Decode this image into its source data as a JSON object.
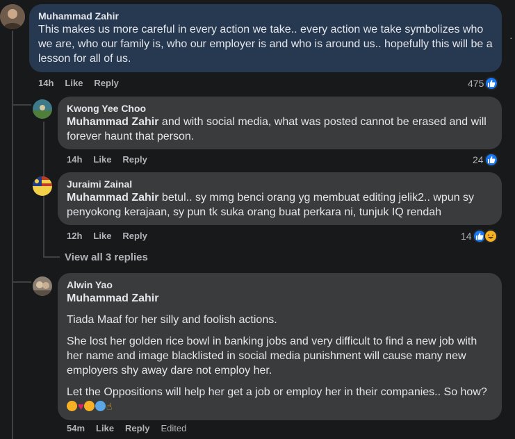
{
  "comments": [
    {
      "author": "Muhammad Zahir",
      "text": "This makes us more careful in every action we take.. every action we take symbolizes who we are, who our family is, who our employer is and who is around us.. hopefully this will be a lesson for all of us.",
      "time": "14h",
      "like_label": "Like",
      "reply_label": "Reply",
      "reaction_count": "475"
    }
  ],
  "replies": [
    {
      "author": "Kwong Yee Choo",
      "mention": "Muhammad Zahir",
      "text": "and with social media, what was posted cannot be erased and will forever haunt that person.",
      "time": "14h",
      "like_label": "Like",
      "reply_label": "Reply",
      "reaction_count": "24"
    },
    {
      "author": "Juraimi Zainal",
      "mention": "Muhammad Zahir",
      "text": "betul.. sy mmg benci orang yg membuat editing jelik2.. wpun sy penyokong kerajaan, sy pun tk suka orang buat perkara ni, tunjuk IQ rendah",
      "time": "12h",
      "like_label": "Like",
      "reply_label": "Reply",
      "reaction_count": "14"
    },
    {
      "author": "Alwin Yao",
      "mention": "Muhammad Zahir",
      "paragraphs": [
        "Tiada Maaf for her silly and foolish actions.",
        "She lost her golden rice bowl in banking jobs and very difficult to find a new job with her name and image blacklisted in social media punishment will cause many new employers shy away dare not employ her.",
        "Let the Oppositions will help her get a job or employ her in their companies.. So how?"
      ],
      "time": "54m",
      "like_label": "Like",
      "reply_label": "Reply",
      "edited_label": "Edited"
    }
  ],
  "view_replies_label": "View all 3 replies",
  "colors": {
    "background": "#18191a",
    "bubble": "#3a3b3c",
    "highlight_bubble": "#263951",
    "like_blue": "#1877f2",
    "secondary_text": "#b0b3b8"
  }
}
